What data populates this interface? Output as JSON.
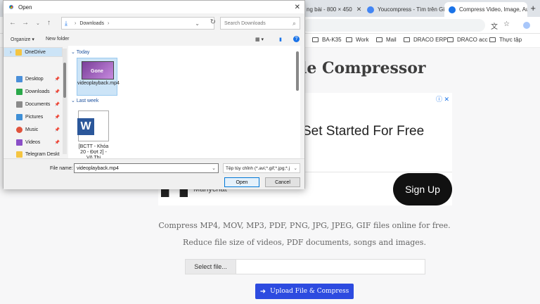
{
  "browser": {
    "tabs": [
      {
        "label": "ng bài - 800 × 450",
        "color": "#9aa0a6"
      },
      {
        "label": "Youcompress - Tìm trên Gi",
        "color": "#4285f4"
      },
      {
        "label": "Compress Video, Image, Au",
        "color": "#1a73e8"
      }
    ],
    "tab_close": "✕",
    "new_tab": "+",
    "bookmarks": [
      "BA-K35",
      "Work",
      "Mail",
      "DRACO ERP",
      "DRACO acc",
      "Thực tập"
    ]
  },
  "page": {
    "title": "le Compressor",
    "ad": {
      "headline": "Set Started For Free",
      "brand": "Manychat",
      "cta": "Sign Up",
      "mark": "ⓘ ✕"
    },
    "desc1": "Compress MP4, MOV, MP3, PDF, PNG, JPG, JPEG, GIF files online for free.",
    "desc2": "Reduce file size of videos, PDF documents, songs and images.",
    "select_label": "Select file...",
    "upload_label": "Upload File & Compress"
  },
  "dialog": {
    "title": "Open",
    "close": "✕",
    "address": {
      "folder": "Downloads"
    },
    "search_placeholder": "Search Downloads",
    "organize": "Organize ▾",
    "new_folder": "New folder",
    "sidebar": [
      {
        "label": "OneDrive",
        "color": "#f5c542",
        "selected": true
      },
      {
        "label": "Desktop",
        "color": "#4a8fd9"
      },
      {
        "label": "Downloads",
        "color": "#2aa84a"
      },
      {
        "label": "Documents",
        "color": "#8a8a8a"
      },
      {
        "label": "Pictures",
        "color": "#3f8fd6"
      },
      {
        "label": "Music",
        "color": "#e0533c"
      },
      {
        "label": "Videos",
        "color": "#8a4fc7"
      },
      {
        "label": "Telegram Deskt",
        "color": "#f5c542"
      }
    ],
    "groups": {
      "today": "Today",
      "last_week": "Last week"
    },
    "files": [
      {
        "name": "videoplayback.mp4",
        "thumb_text": "Gone"
      },
      {
        "name": "[BCTT - Khóa 20 - Đợt 2] - Võ Thị",
        "thumb_text": "W"
      }
    ],
    "filename_label": "File name:",
    "filename_value": "videoplayback.mp4",
    "filetype_value": "Tệp tùy chỉnh (*.avi;*.gif;*.jpg;*.j",
    "open_label": "Open",
    "cancel_label": "Cancel"
  }
}
